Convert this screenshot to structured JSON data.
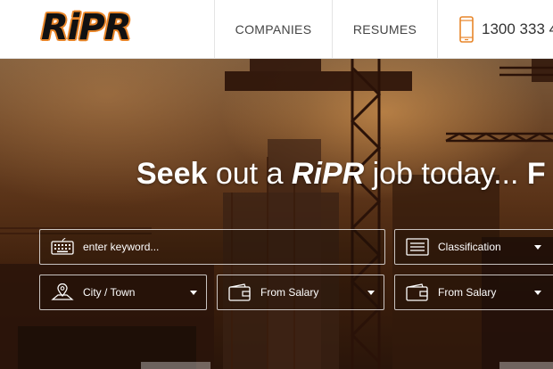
{
  "header": {
    "logo_text": "RiPR",
    "nav": [
      {
        "label": "COMPANIES"
      },
      {
        "label": "RESUMES"
      }
    ],
    "phone": {
      "icon": "phone-icon",
      "number": "1300 333 4"
    }
  },
  "hero": {
    "title_part1": "Seek",
    "title_part2": " out a ",
    "title_part3": "RiPR",
    "title_part4": " job today... ",
    "title_part5": "F"
  },
  "search": {
    "keyword_placeholder": "enter keyword...",
    "classification_label": "Classification",
    "city_label": "City / Town",
    "from_salary_label": "From Salary",
    "to_salary_label": "From Salary"
  },
  "colors": {
    "brand_orange": "#e8862a",
    "hero_text": "#ffffff"
  }
}
